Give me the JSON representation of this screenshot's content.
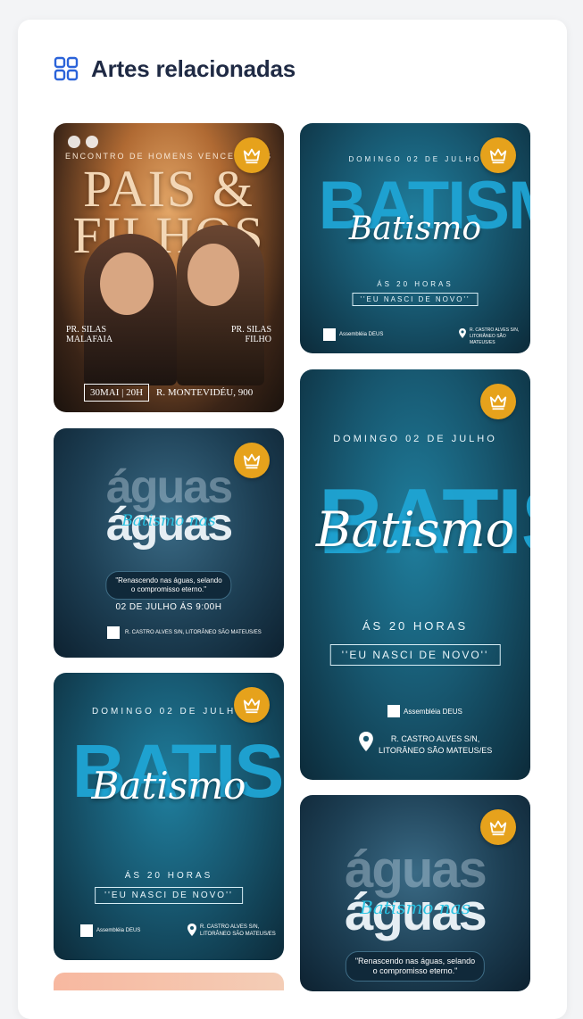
{
  "section": {
    "title": "Artes relacionadas",
    "icon": "grid-icon"
  },
  "colors": {
    "title": "#1f2a44",
    "icon": "#2b63d9",
    "crown_badge": "#e6a21c"
  },
  "cards": {
    "pais": {
      "kicker": "ENCONTRO DE HOMENS VENCEDORES",
      "title_line1": "PAIS &",
      "title_line2": "FILHOS",
      "speaker1_line1": "PR. SILAS",
      "speaker1_line2": "MALAFAIA",
      "speaker2_line1": "PR. SILAS",
      "speaker2_line2": "FILHO",
      "date": "30MAI | 20H",
      "address": "R. MONTEVIDÉU, 900",
      "badge": "crown-icon"
    },
    "batismo": {
      "date": "DOMINGO 02 DE JULHO",
      "block_word": "BATISMO",
      "script": "Batismo",
      "hours": "ÁS 20 HORAS",
      "quote": "''EU NASCI DE NOVO''",
      "org": "Assembléia DEUS",
      "address_line1": "R. CASTRO ALVES S/N,",
      "address_line2": "LITORÂNEO SÃO MATEUS/ES",
      "badge": "crown-icon"
    },
    "aguas": {
      "word": "águas",
      "script": "Batismo nas",
      "quote_line1": "\"Renascendo nas águas, selando",
      "quote_line2": "o compromisso eterno.\"",
      "when": "02 DE JULHO ÁS 9:00H",
      "address": "R. CASTRO ALVES S/N, LITORÂNEO SÃO MATEUS/ES",
      "badge": "crown-icon"
    }
  }
}
